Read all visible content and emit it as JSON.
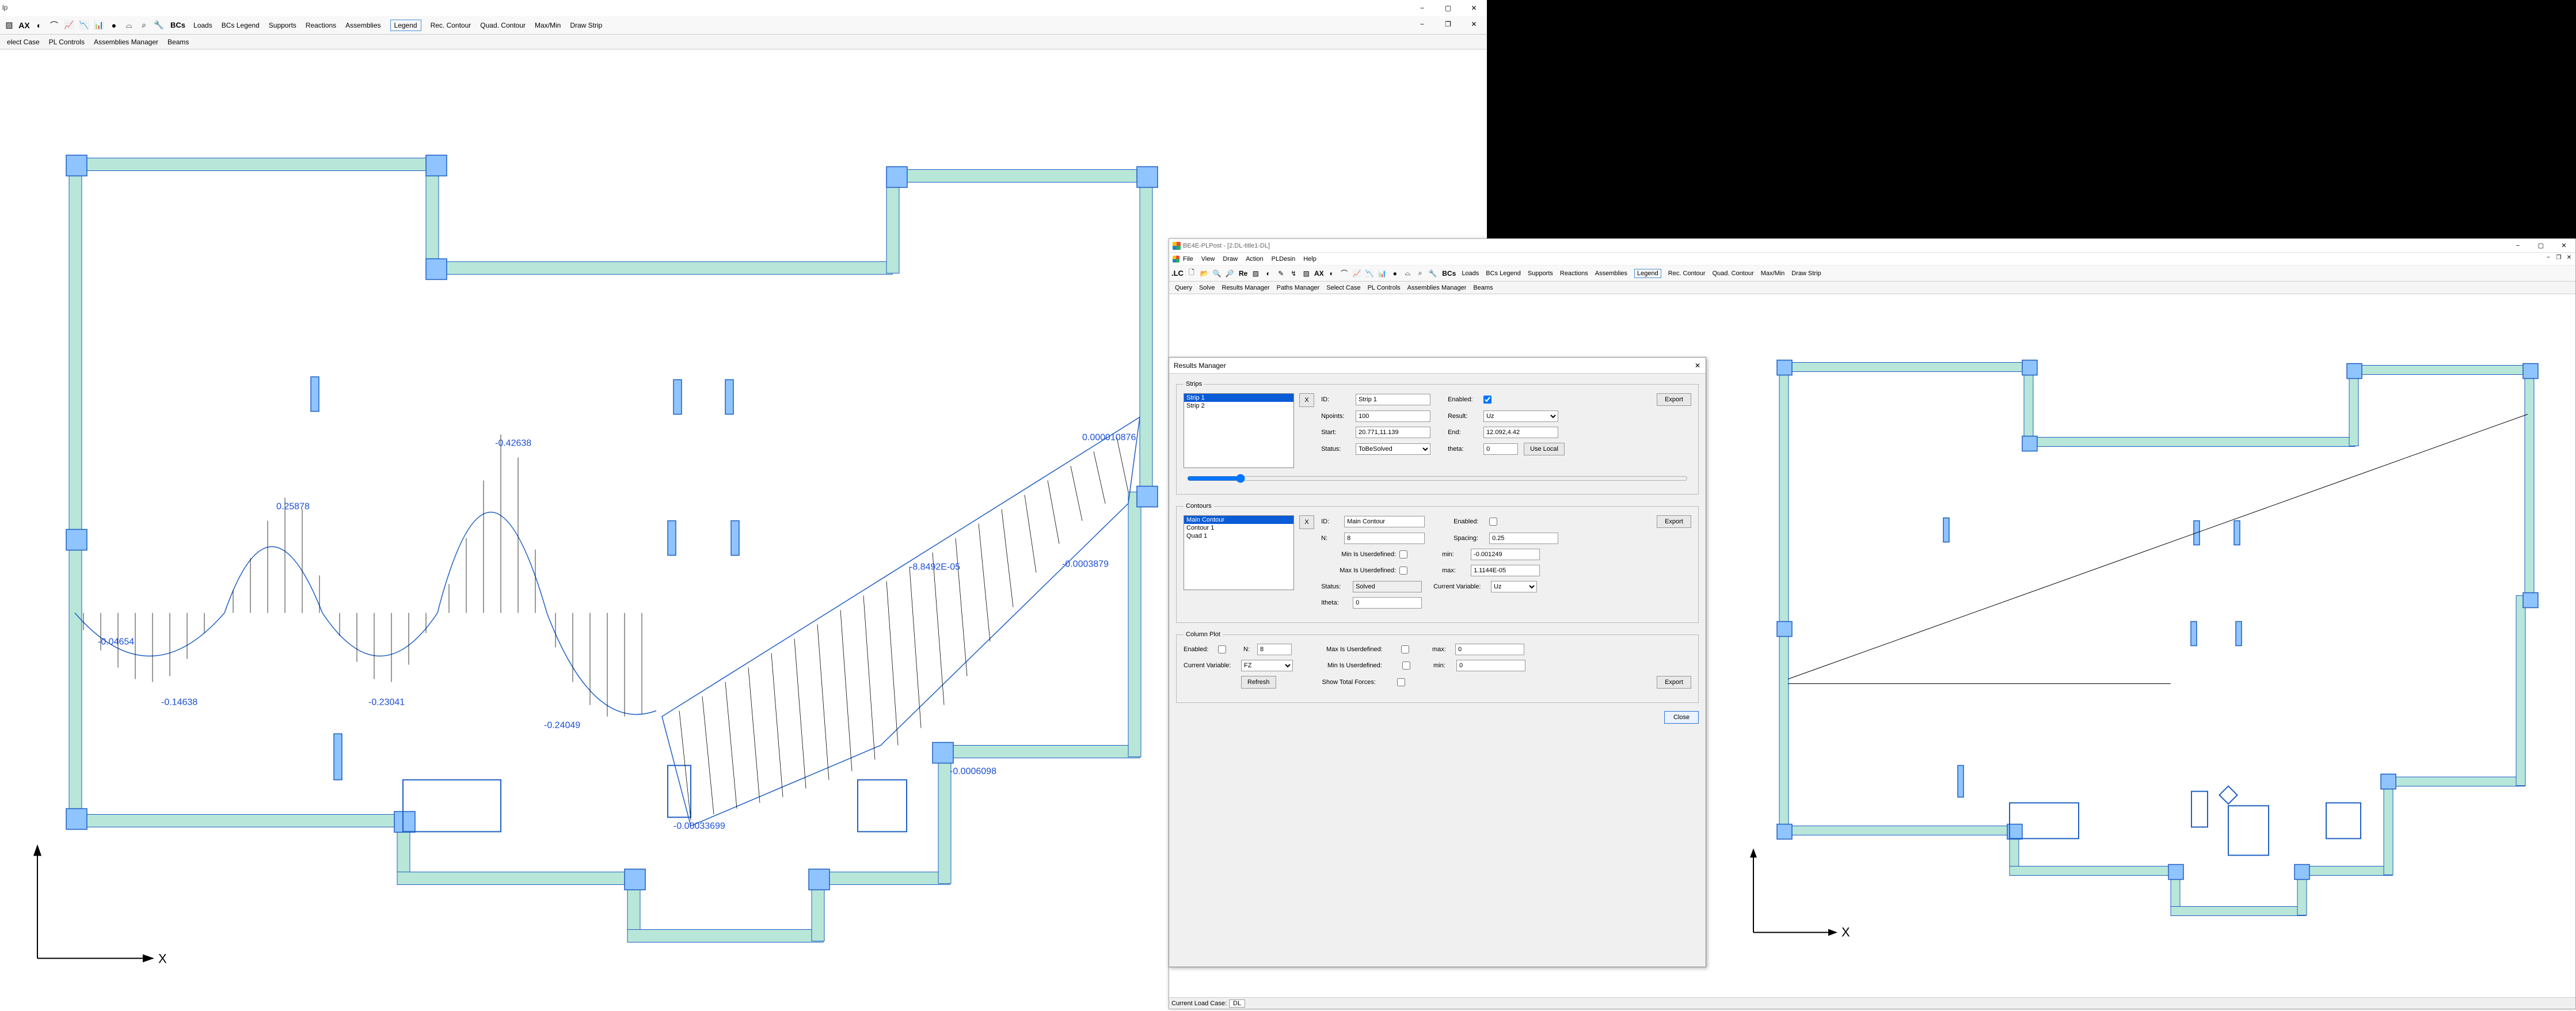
{
  "left": {
    "menu_partial": "lp",
    "toolbar_label_bcs": "BCs",
    "toolbar_buttons": [
      "Loads",
      "BCs Legend",
      "Supports",
      "Reactions",
      "Assemblies",
      "Legend",
      "Rec. Contour",
      "Quad. Contour",
      "Max/Min",
      "Draw Strip"
    ],
    "toolbar_buttons_active_index": 5,
    "toolbar2_buttons": [
      "elect Case",
      "PL Controls",
      "Assemblies Manager",
      "Beams"
    ],
    "axis_label": "X",
    "annotations": {
      "a1": "0.25878",
      "a2": "-0.42638",
      "a3": "0.000010876",
      "a4": "-0.04654",
      "a5": "-0.14638",
      "a6": "-0.23041",
      "a7": "-0.24049",
      "a8": "-0.00033699",
      "a9": "-8.8492E-05",
      "a10": "-0.0003879",
      "a11": "-0.0006098"
    },
    "window_controls": {
      "min": "−",
      "max": "▢",
      "close": "✕",
      "restore": "❐"
    }
  },
  "right": {
    "title": "BE4E-PLPost - [2.DL-title1-DL]",
    "menus": [
      "File",
      "View",
      "Draw",
      "Action",
      "PLDesin",
      "Help"
    ],
    "toolbar_label_lc": ".LC",
    "toolbar_label_re": "Re",
    "toolbar_label_bcs": "BCs",
    "toolbar_buttons": [
      "Loads",
      "BCs Legend",
      "Supports",
      "Reactions",
      "Assemblies",
      "Legend",
      "Rec. Contour",
      "Quad. Contour",
      "Max/Min",
      "Draw Strip"
    ],
    "toolbar_buttons_active_index": 5,
    "toolbar2_buttons": [
      "Query",
      "Solve",
      "Results Manager",
      "Paths Manager",
      "Select Case",
      "PL Controls",
      "Assemblies Manager",
      "Beams"
    ],
    "axis_label": "X",
    "status_label": "Current Load Case:",
    "status_value": "DL",
    "window_controls": {
      "min": "−",
      "max": "▢",
      "close": "✕"
    },
    "mdi_controls": {
      "min": "−",
      "max": "❐",
      "close": "✕"
    }
  },
  "dialog": {
    "title": "Results Manager",
    "close_x": "✕",
    "strips": {
      "legend": "Strips",
      "items": [
        {
          "label": "Strip 1",
          "selected": true
        },
        {
          "label": "Strip 2",
          "selected": false
        }
      ],
      "xbtn": "X",
      "id_label": "ID:",
      "id_value": "Strip 1",
      "enabled_label": "Enabled:",
      "enabled_checked": true,
      "export": "Export",
      "npoints_label": "Npoints:",
      "npoints_value": "100",
      "result_label": "Result:",
      "result_value": "Uz",
      "start_label": "Start:",
      "start_value": "20.771,11.139",
      "end_label": "End:",
      "end_value": "12.092,4.42",
      "status_label": "Status:",
      "status_value": "ToBeSolved",
      "theta_label": "theta:",
      "theta_value": "0",
      "use_local": "Use Local"
    },
    "contours": {
      "legend": "Contours",
      "items": [
        {
          "label": "Main Contour",
          "selected": true
        },
        {
          "label": "Contour 1",
          "selected": false
        },
        {
          "label": "Quad 1",
          "selected": false
        }
      ],
      "xbtn": "X",
      "id_label": "ID:",
      "id_value": "Main Contour",
      "enabled_label": "Enabled:",
      "enabled_checked": false,
      "export": "Export",
      "n_label": "N:",
      "n_value": "8",
      "spacing_label": "Spacing:",
      "spacing_value": "0.25",
      "min_ud_label": "Min Is Userdefined:",
      "min_ud_checked": false,
      "min_label": "min:",
      "min_value": "-0.001249",
      "max_ud_label": "Max Is Userdefined:",
      "max_ud_checked": false,
      "max_label": "max:",
      "max_value": "1.1144E-05",
      "status_label": "Status:",
      "status_value": "Solved",
      "curvar_label": "Current Variable:",
      "curvar_value": "Uz",
      "itheta_label": "Itheta:",
      "itheta_value": "0"
    },
    "column_plot": {
      "legend": "Column Plot",
      "enabled_label": "Enabled:",
      "enabled_checked": false,
      "n_label": "N:",
      "n_value": "8",
      "max_ud_label": "Max Is Userdefined:",
      "max_ud_checked": false,
      "max_label": "max:",
      "max_value": "0",
      "curvar_label": "Current Variable:",
      "curvar_value": "FZ",
      "min_ud_label": "Min Is Userdefined:",
      "min_ud_checked": false,
      "min_label": "min:",
      "min_value": "0",
      "refresh": "Refresh",
      "show_total_label": "Show Total Forces:",
      "show_total_checked": false,
      "export": "Export"
    },
    "close_btn": "Close"
  }
}
